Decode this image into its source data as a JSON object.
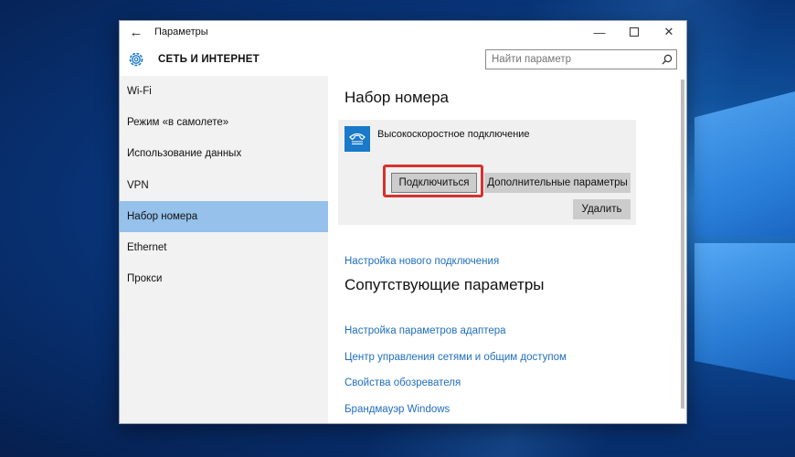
{
  "window": {
    "title": "Параметры",
    "back_icon": "arrow-left-icon",
    "controls": [
      "minimize-icon",
      "maximize-icon",
      "close-icon"
    ]
  },
  "header": {
    "heading": "СЕТЬ И ИНТЕРНЕТ",
    "icon": "gear-icon",
    "search_placeholder": "Найти параметр"
  },
  "sidebar": {
    "items": [
      {
        "label": "Wi-Fi",
        "active": false
      },
      {
        "label": "Режим «в самолете»",
        "active": false
      },
      {
        "label": "Использование данных",
        "active": false
      },
      {
        "label": "VPN",
        "active": false
      },
      {
        "label": "Набор номера",
        "active": true
      },
      {
        "label": "Ethernet",
        "active": false
      },
      {
        "label": "Прокси",
        "active": false
      }
    ]
  },
  "main": {
    "title": "Набор номера",
    "connection": {
      "name": "Высокоскоростное подключение",
      "icon": "phone-icon",
      "connect_label": "Подключиться",
      "advanced_label": "Дополнительные параметры",
      "delete_label": "Удалить"
    },
    "new_connection_link": "Настройка нового подключения",
    "related_title": "Сопутствующие параметры",
    "related_links": [
      "Настройка параметров адаптера",
      "Центр управления сетями и общим доступом",
      "Свойства обозревателя",
      "Брандмауэр Windows"
    ]
  },
  "colors": {
    "accent": "#1a79c9",
    "active_nav": "#95c1ea",
    "link": "#1f6ec0",
    "highlight": "#d7322f"
  }
}
